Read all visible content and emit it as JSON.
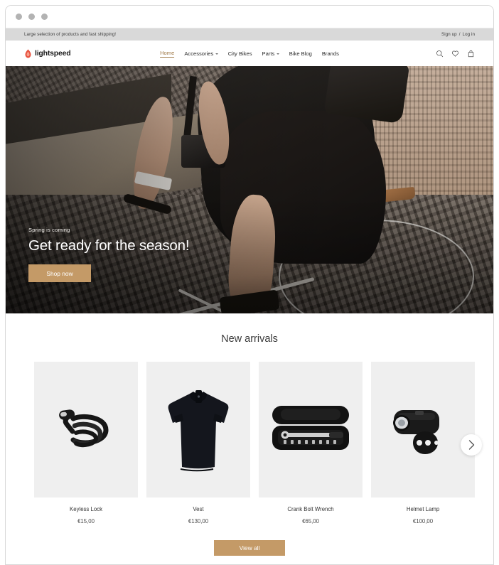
{
  "window": {
    "dots": [
      "window-close",
      "window-minimize",
      "window-zoom"
    ]
  },
  "announcement": {
    "message": "Large selection of products and fast shipping!",
    "signup_label": "Sign up",
    "separator": "/",
    "login_label": "Log in"
  },
  "header": {
    "logo_text": "lightspeed",
    "logo_icon": "flame-icon",
    "nav": [
      {
        "label": "Home",
        "active": true,
        "has_caret": false
      },
      {
        "label": "Accessories",
        "active": false,
        "has_caret": true
      },
      {
        "label": "City Bikes",
        "active": false,
        "has_caret": false
      },
      {
        "label": "Parts",
        "active": false,
        "has_caret": true
      },
      {
        "label": "Bike Blog",
        "active": false,
        "has_caret": false
      },
      {
        "label": "Brands",
        "active": false,
        "has_caret": false
      }
    ],
    "icons": [
      "search-icon",
      "wishlist-heart-icon",
      "shopping-bag-icon"
    ]
  },
  "hero": {
    "kicker": "Spring is coming",
    "title": "Get ready for the season!",
    "cta_label": "Shop now",
    "image_alt": "Cyclist riding a bicycle on a cobblestone street"
  },
  "arrivals": {
    "title": "New arrivals",
    "next_arrow": "chevron-right-icon",
    "view_all_label": "View all",
    "products": [
      {
        "name": "Keyless Lock",
        "price": "€15,00",
        "image": "coiled-cable-lock"
      },
      {
        "name": "Vest",
        "price": "€130,00",
        "image": "cycling-jersey"
      },
      {
        "name": "Crank Bolt Wrench",
        "price": "€65,00",
        "image": "torque-wrench-case"
      },
      {
        "name": "Helmet Lamp",
        "price": "€100,00",
        "image": "bike-light"
      }
    ]
  },
  "colors": {
    "accent_tan": "#c49a67",
    "announce_bar": "#d9d9d9",
    "product_bg": "#efefef",
    "active_nav": "#a07a47"
  }
}
